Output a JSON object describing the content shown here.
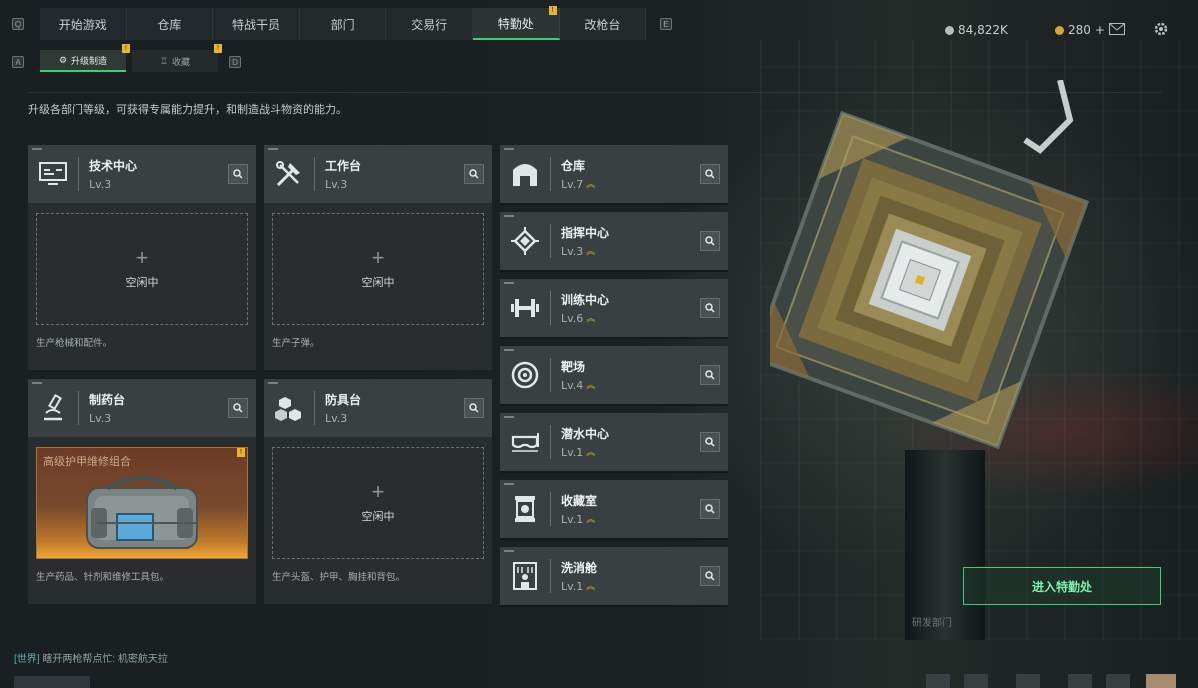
{
  "nav": {
    "left_key": "Q",
    "right_key": "E",
    "tabs": [
      {
        "label": "开始游戏",
        "active": false,
        "badge": ""
      },
      {
        "label": "仓库",
        "active": false,
        "badge": ""
      },
      {
        "label": "特战干员",
        "active": false,
        "badge": ""
      },
      {
        "label": "部门",
        "active": false,
        "badge": ""
      },
      {
        "label": "交易行",
        "active": false,
        "badge": ""
      },
      {
        "label": "特勤处",
        "active": true,
        "badge": "!"
      },
      {
        "label": "改枪台",
        "active": false,
        "badge": ""
      }
    ]
  },
  "currency": {
    "coins": "84,822K",
    "tickets": "280",
    "tickets_add": "+"
  },
  "subnav": {
    "left_key": "A",
    "right_key": "D",
    "tabs": [
      {
        "label": "升级制造",
        "active": true,
        "badge": "!"
      },
      {
        "label": "收藏",
        "active": false,
        "badge": "!"
      }
    ]
  },
  "description": "升级各部门等级，可获得专属能力提升，和制造战斗物资的能力。",
  "production": [
    {
      "name": "技术中心",
      "level": "Lv.3",
      "slot": "空闲中",
      "foot": "生产枪械和配件。",
      "icon": "monitor-icon"
    },
    {
      "name": "工作台",
      "level": "Lv.3",
      "slot": "空闲中",
      "foot": "生产子弹。",
      "icon": "tools-icon"
    },
    {
      "name": "制药台",
      "level": "Lv.3",
      "slot": "",
      "item": "高级护甲维修组合",
      "item_badge": "!",
      "foot": "生产药品、针剂和维修工具包。",
      "icon": "microscope-icon"
    },
    {
      "name": "防具台",
      "level": "Lv.3",
      "slot": "空闲中",
      "foot": "生产头盔、护甲、胸挂和背包。",
      "icon": "boxes-icon"
    }
  ],
  "facilities": [
    {
      "name": "仓库",
      "level": "Lv.7",
      "icon": "warehouse-icon"
    },
    {
      "name": "指挥中心",
      "level": "Lv.3",
      "icon": "command-icon"
    },
    {
      "name": "训练中心",
      "level": "Lv.6",
      "icon": "dumbbell-icon"
    },
    {
      "name": "靶场",
      "level": "Lv.4",
      "icon": "target-icon"
    },
    {
      "name": "潜水中心",
      "level": "Lv.1",
      "icon": "diving-mask-icon"
    },
    {
      "name": "收藏室",
      "level": "Lv.1",
      "icon": "display-case-icon"
    },
    {
      "name": "洗消舱",
      "level": "Lv.1",
      "icon": "decon-icon"
    }
  ],
  "upgrade_glyph": "︽",
  "enter_button": "进入特勤处",
  "chat": {
    "channel": "[世界]",
    "message": "瞎开两枪帮点忙: 机密航天拉"
  },
  "pillar_label": "研发部门",
  "colors": {
    "accent_green": "#2fd37a",
    "badge_yellow": "#e8b62d",
    "upgrade_gold": "#e0b332"
  }
}
